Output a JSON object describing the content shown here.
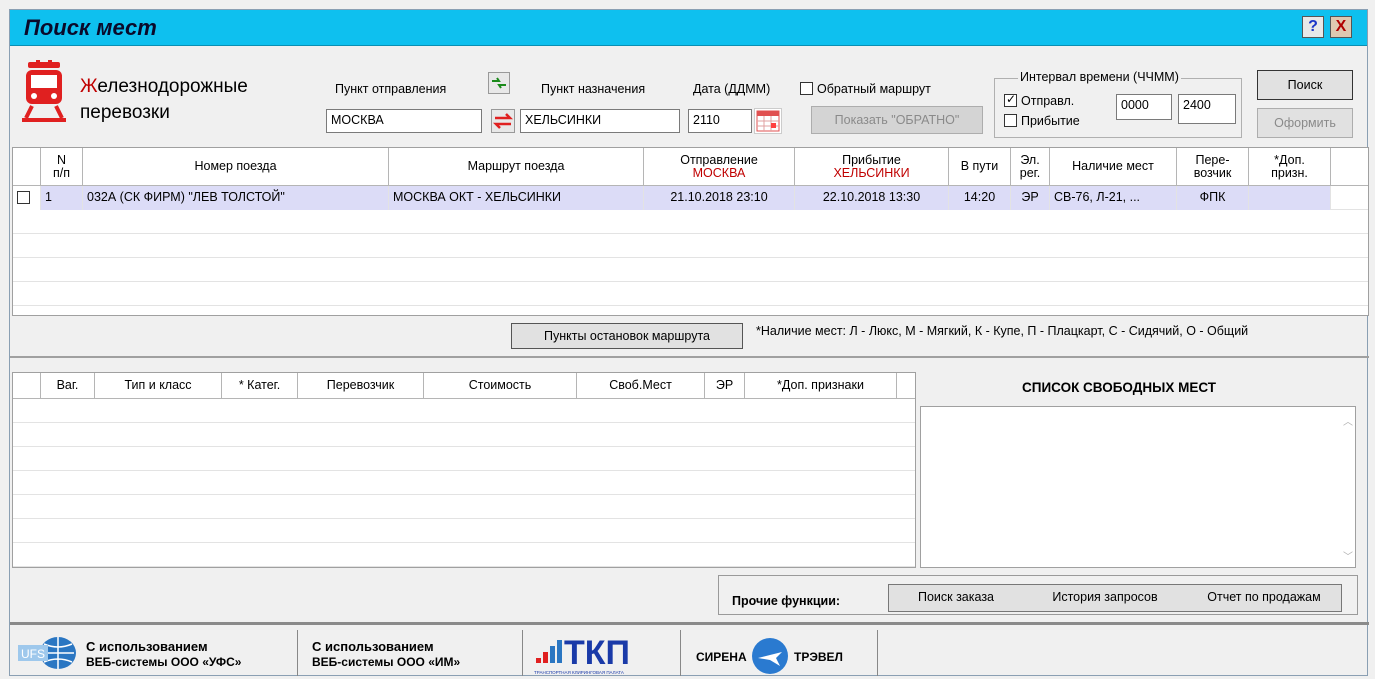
{
  "window": {
    "title": "Поиск мест",
    "help_label": "?",
    "close_label": "X"
  },
  "brand": {
    "line1_initial": "Ж",
    "line1_rest": "елезнодорожные",
    "line2": "перевозки"
  },
  "search": {
    "from_label": "Пункт отправления",
    "from_value": "МОСКВА",
    "to_label": "Пункт назначения",
    "to_value": "ХЕЛЬСИНКИ",
    "date_label": "Дата (ДДММ)",
    "date_value": "2110",
    "return_route_label": "Обратный маршрут",
    "show_return_label": "Показать \"ОБРАТНО\"",
    "interval_label": "Интервал времени (ЧЧММ)",
    "departure_label": "Отправл.",
    "arrival_label": "Прибытие",
    "time_from": "0000",
    "time_to": "2400",
    "search_button": "Поиск",
    "issue_button": "Оформить"
  },
  "trains_table": {
    "headers": {
      "num_line1": "N",
      "num_line2": "п/п",
      "train": "Номер поезда",
      "route": "Маршрут поезда",
      "departure": "Отправление",
      "departure_city": "МОСКВА",
      "arrival": "Прибытие",
      "arrival_city": "ХЕЛЬСИНКИ",
      "travel": "В пути",
      "el_line1": "Эл.",
      "el_line2": "рег.",
      "seats": "Наличие мест",
      "carrier_line1": "Пере-",
      "carrier_line2": "возчик",
      "extra_line1": "*Доп.",
      "extra_line2": "призн."
    },
    "rows": [
      {
        "num": "1",
        "train": "032А  (СК ФИРМ)  \"ЛЕВ ТОЛСТОЙ\"",
        "route": "МОСКВА ОКТ - ХЕЛЬСИНКИ",
        "departure": "21.10.2018  23:10",
        "arrival": "22.10.2018  13:30",
        "travel": "14:20",
        "el": "ЭР",
        "seats": "СВ-76, Л-21, ...",
        "carrier": "ФПК",
        "extra": ""
      }
    ]
  },
  "stops_button": "Пункты остановок маршрута",
  "seats_legend": "*Наличие мест:  Л - Люкс, М - Мягкий, К - Купе, П - Плацкарт,  С - Сидячий, О - Общий",
  "cars_table": {
    "headers": {
      "car": "Ваг.",
      "type": "Тип и класс",
      "category": "* Катег.",
      "carrier": "Перевозчик",
      "price": "Стоимость",
      "free": "Своб.Мест",
      "er": "ЭР",
      "extra": "*Доп. признаки"
    }
  },
  "free_seats_title": "СПИСОК СВОБОДНЫХ МЕСТ",
  "other_functions": {
    "label": "Прочие функции:",
    "order_search": "Поиск заказа",
    "history": "История запросов",
    "sales_report": "Отчет по продажам"
  },
  "footer": {
    "ufs_line1": "С использованием",
    "ufs_line2": "ВЕБ-системы ООО «УФС»",
    "ufs_logo": "UFS",
    "im_line1": "С использованием",
    "im_line2": "ВЕБ-системы ООО «ИМ»",
    "tkp_logo": "ТКП",
    "tkp_caption": "ТРАНСПОРТНАЯ КЛИРИНГОВАЯ ПАЛАТА",
    "sirena_left": "СИРЕНА",
    "sirena_right": "ТРЭВЕЛ"
  },
  "colors": {
    "titlebar": "#0ec0ef",
    "selected_row": "#dcdcf7",
    "accent_red": "#c00000"
  }
}
